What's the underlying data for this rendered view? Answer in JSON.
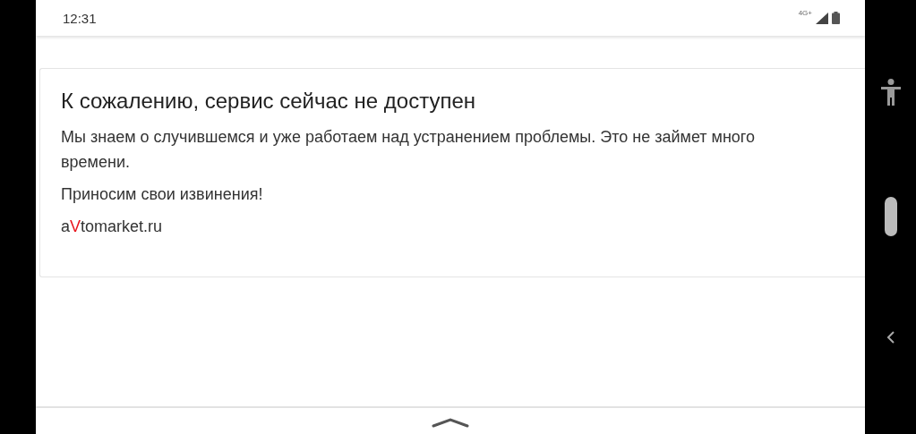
{
  "status_bar": {
    "time": "12:31",
    "network": "4G+"
  },
  "card": {
    "title": "К сожалению, сервис сейчас не доступен",
    "paragraphs": [
      "Мы знаем о случившемся и уже работаем над устранением проблемы. Это не займет много времени.",
      "Приносим свои извинения!"
    ],
    "logo": [
      {
        "text": "a",
        "color": "#333333"
      },
      {
        "text": "V",
        "color": "#e8141c"
      },
      {
        "text": "tomarket.ru",
        "color": "#333333"
      }
    ]
  }
}
